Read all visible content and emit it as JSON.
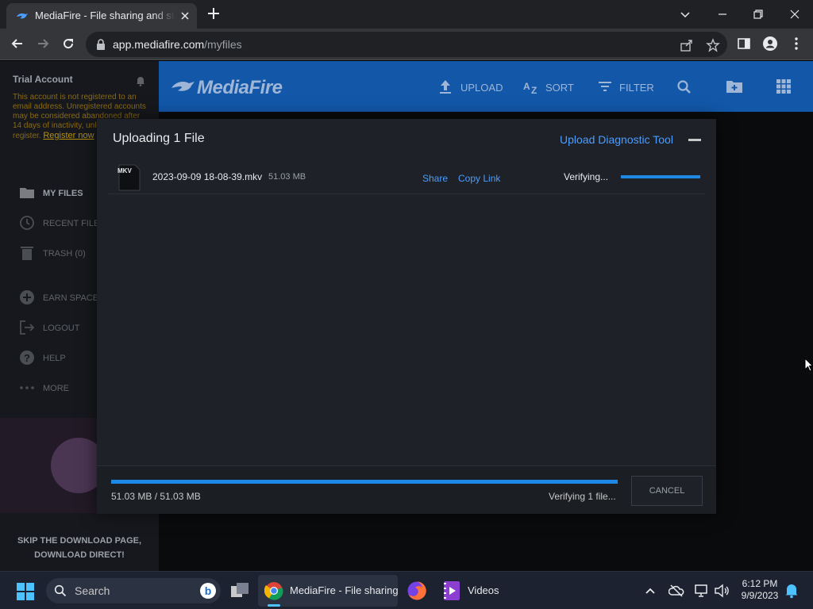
{
  "browser": {
    "tab_title": "MediaFire - File sharing and storage",
    "url_host": "app.mediafire.com",
    "url_path": "/myfiles"
  },
  "sidebar": {
    "account_title": "Trial Account",
    "warning_text": "This account is not registered to an email address. Unregistered accounts may be considered abandoned after 14 days of inactivity, unless you register.",
    "register_link": "Register now",
    "items": [
      {
        "label": "MY FILES",
        "icon": "folder-icon"
      },
      {
        "label": "RECENT FILES",
        "icon": "clock-icon"
      },
      {
        "label": "TRASH (0)",
        "icon": "trash-icon"
      },
      {
        "label": "EARN SPACE",
        "icon": "plus-circle-icon"
      },
      {
        "label": "LOGOUT",
        "icon": "logout-icon"
      },
      {
        "label": "HELP",
        "icon": "help-icon"
      },
      {
        "label": "MORE",
        "icon": "more-icon"
      }
    ],
    "skip_text": "SKIP THE DOWNLOAD PAGE, DOWNLOAD DIRECT!"
  },
  "header": {
    "logo": "MediaFire",
    "upload": "UPLOAD",
    "sort": "SORT",
    "filter": "FILTER"
  },
  "modal": {
    "title": "Uploading 1 File",
    "diagnostic_link": "Upload Diagnostic Tool",
    "file": {
      "ext": "MKV",
      "name": "2023-09-09 18-08-39.mkv",
      "size": "51.03 MB",
      "share": "Share",
      "copy_link": "Copy Link",
      "status": "Verifying...",
      "progress": 1.0
    },
    "footer": {
      "transferred": "51.03 MB / 51.03 MB",
      "status": "Verifying 1 file...",
      "progress": 1.0,
      "cancel": "CANCEL"
    }
  },
  "taskbar": {
    "search_placeholder": "Search",
    "apps": [
      {
        "label": "MediaFire - File sharing",
        "icon": "chrome-icon"
      },
      {
        "label": "Videos",
        "icon": "videos-icon"
      }
    ],
    "time": "6:12 PM",
    "date": "9/9/2023"
  },
  "colors": {
    "accent": "#1e88e5",
    "link": "#4a9eff",
    "header_bg": "#1257a8",
    "warning": "#8a6a10"
  }
}
